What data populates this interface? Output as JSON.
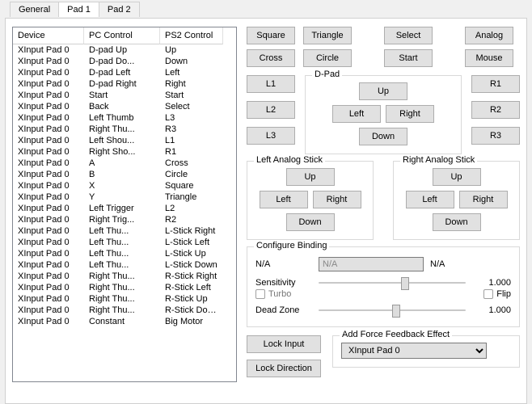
{
  "tabs": {
    "general": "General",
    "pad1": "Pad 1",
    "pad2": "Pad 2"
  },
  "headers": {
    "device": "Device",
    "pc": "PC Control",
    "ps2": "PS2 Control"
  },
  "rows": [
    {
      "dev": "XInput Pad 0",
      "pc": "D-pad Up",
      "ps2": "Up"
    },
    {
      "dev": "XInput Pad 0",
      "pc": "D-pad Do...",
      "ps2": "Down"
    },
    {
      "dev": "XInput Pad 0",
      "pc": "D-pad Left",
      "ps2": "Left"
    },
    {
      "dev": "XInput Pad 0",
      "pc": "D-pad Right",
      "ps2": "Right"
    },
    {
      "dev": "XInput Pad 0",
      "pc": "Start",
      "ps2": "Start"
    },
    {
      "dev": "XInput Pad 0",
      "pc": "Back",
      "ps2": "Select"
    },
    {
      "dev": "XInput Pad 0",
      "pc": "Left Thumb",
      "ps2": "L3"
    },
    {
      "dev": "XInput Pad 0",
      "pc": "Right Thu...",
      "ps2": "R3"
    },
    {
      "dev": "XInput Pad 0",
      "pc": "Left Shou...",
      "ps2": "L1"
    },
    {
      "dev": "XInput Pad 0",
      "pc": "Right Sho...",
      "ps2": "R1"
    },
    {
      "dev": "XInput Pad 0",
      "pc": "A",
      "ps2": "Cross"
    },
    {
      "dev": "XInput Pad 0",
      "pc": "B",
      "ps2": "Circle"
    },
    {
      "dev": "XInput Pad 0",
      "pc": "X",
      "ps2": "Square"
    },
    {
      "dev": "XInput Pad 0",
      "pc": "Y",
      "ps2": "Triangle"
    },
    {
      "dev": "XInput Pad 0",
      "pc": "Left Trigger",
      "ps2": "L2"
    },
    {
      "dev": "XInput Pad 0",
      "pc": "Right Trig...",
      "ps2": "R2"
    },
    {
      "dev": "XInput Pad 0",
      "pc": "Left Thu...",
      "ps2": "L-Stick Right"
    },
    {
      "dev": "XInput Pad 0",
      "pc": "Left Thu...",
      "ps2": "L-Stick Left"
    },
    {
      "dev": "XInput Pad 0",
      "pc": "Left Thu...",
      "ps2": "L-Stick Up"
    },
    {
      "dev": "XInput Pad 0",
      "pc": "Left Thu...",
      "ps2": "L-Stick Down"
    },
    {
      "dev": "XInput Pad 0",
      "pc": "Right Thu...",
      "ps2": "R-Stick Right"
    },
    {
      "dev": "XInput Pad 0",
      "pc": "Right Thu...",
      "ps2": "R-Stick Left"
    },
    {
      "dev": "XInput Pad 0",
      "pc": "Right Thu...",
      "ps2": "R-Stick Up"
    },
    {
      "dev": "XInput Pad 0",
      "pc": "Right Thu...",
      "ps2": "R-Stick Down"
    },
    {
      "dev": "XInput Pad 0",
      "pc": "Constant",
      "ps2": "Big Motor"
    }
  ],
  "buttons": {
    "square": "Square",
    "triangle": "Triangle",
    "select": "Select",
    "analog": "Analog",
    "cross": "Cross",
    "circle": "Circle",
    "start": "Start",
    "mouse": "Mouse",
    "l1": "L1",
    "l2": "L2",
    "l3": "L3",
    "r1": "R1",
    "r2": "R2",
    "r3": "R3",
    "up": "Up",
    "down": "Down",
    "left": "Left",
    "right": "Right"
  },
  "groups": {
    "dpad": "D-Pad",
    "lstick": "Left Analog Stick",
    "rstick": "Right Analog Stick",
    "config": "Configure Binding",
    "ff": "Add Force Feedback Effect"
  },
  "config": {
    "na": "N/A",
    "combo_na": "N/A",
    "right_na": "N/A",
    "sensitivity_label": "Sensitivity",
    "sensitivity_value": "1.000",
    "turbo_label": "Turbo",
    "flip_label": "Flip",
    "deadzone_label": "Dead Zone",
    "deadzone_value": "1.000"
  },
  "lock": {
    "input": "Lock Input",
    "direction": "Lock Direction"
  },
  "ff": {
    "device": "XInput Pad 0"
  }
}
